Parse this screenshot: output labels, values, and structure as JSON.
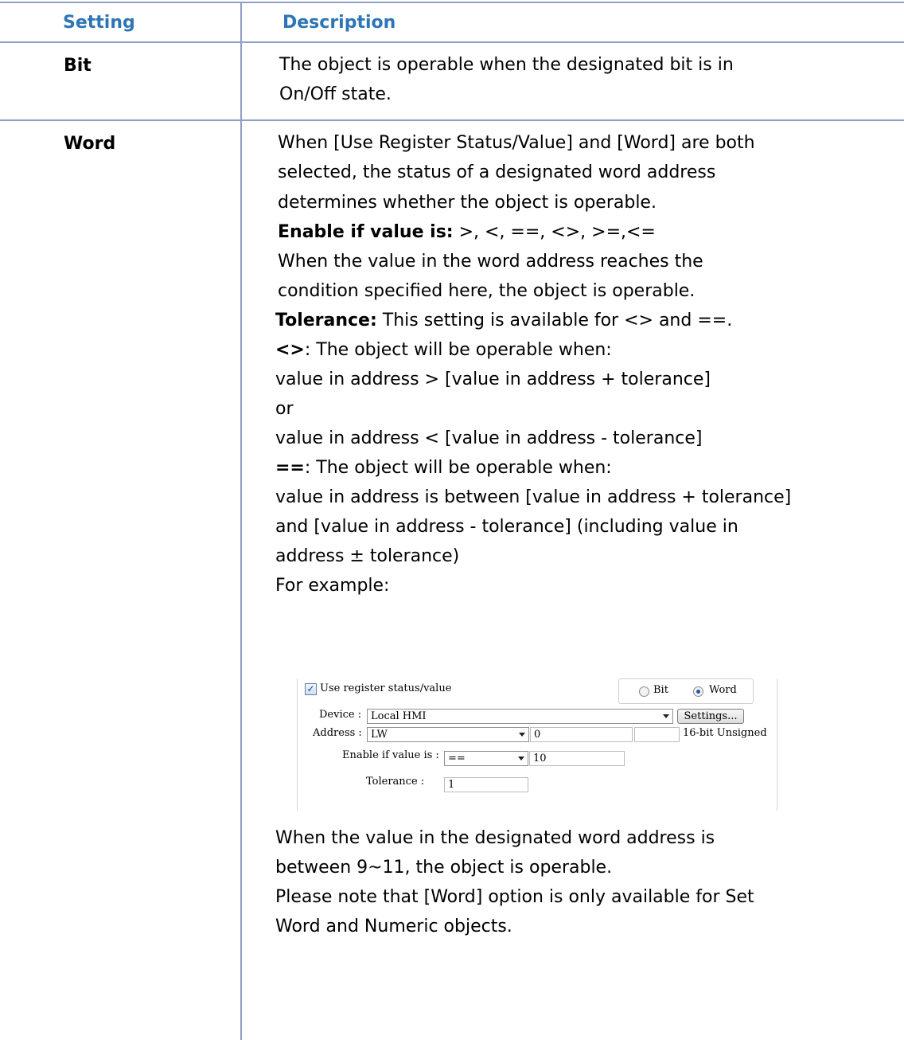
{
  "header": {
    "setting": "Setting",
    "description": "Description"
  },
  "rows": {
    "bit": {
      "setting": "Bit",
      "lines": [
        "The object is operable when the designated bit is in",
        "On/Off state."
      ]
    },
    "word": {
      "setting": "Word",
      "intro": [
        "When [Use Register Status/Value] and [Word] are both",
        "selected, the status of a designated word address",
        "determines whether the object is operable."
      ],
      "enable_label": "Enable if value is:",
      "enable_value": " >, <, ==, <>, >=,<=",
      "condition": [
        "When the value in the word address reaches the",
        "condition specified here, the object is operable."
      ],
      "tolerance_label": "Tolerance:",
      "tolerance_text": " This setting is available for <> and ==.",
      "ne_label": "<>",
      "ne_text": ": The object will be operable when:",
      "ne_lines": [
        "value in address > [value in address + tolerance]",
        "or",
        "value in address < [value in address - tolerance]"
      ],
      "eq_label": "==",
      "eq_text": ": The object will be operable when:",
      "eq_lines": [
        "value in address is between [value in address + tolerance]",
        "and [value in address - tolerance] (including value in",
        "address ± tolerance)",
        "For example:"
      ],
      "outro": [
        "When the value in the designated word address is",
        "between 9~11, the object is operable.",
        "Please note that [Word] option is only available for Set",
        "Word and Numeric objects."
      ]
    }
  },
  "dialog": {
    "use_register_label": "Use register status/value",
    "use_register_checked": true,
    "radio_bit": "Bit",
    "radio_word": "Word",
    "selected_mode": "Word",
    "device_label": "Device :",
    "device_value": "Local HMI",
    "settings_button": "Settings...",
    "address_label": "Address :",
    "address_type": "LW",
    "address_value": "0",
    "address_format": "16-bit Unsigned",
    "enable_label": "Enable if value is :",
    "enable_operator": "==",
    "enable_value": "10",
    "tolerance_label": "Tolerance :",
    "tolerance_value": "1"
  }
}
